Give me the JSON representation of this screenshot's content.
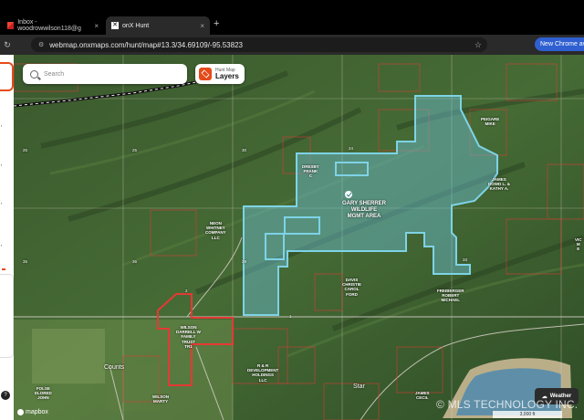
{
  "browser": {
    "tabs": [
      {
        "title": "Inbox - woodrowwilson118@g",
        "icon": "gmail-icon",
        "active": false
      },
      {
        "title": "onX Hunt",
        "icon": "onx-icon",
        "active": true
      }
    ],
    "new_tab": "+",
    "url": "webmap.onxmaps.com/hunt/map#13.3/34.69109/-95.53823",
    "chrome_button": "New Chrome ava"
  },
  "map_ui": {
    "search_placeholder": "Search",
    "layers_small": "Hunt Map",
    "layers_big": "Layers",
    "weather": "Weather",
    "mapbox": "mapbox",
    "scale": [
      "",
      "3,000 ft",
      ""
    ],
    "watermark": "© MLS TECHNOLOGY INC."
  },
  "labels": {
    "wma": "GARY SHERRER\nWILDLIFE\nMGMT AREA",
    "pegasus": "PEIGARE\nMIKE",
    "james": "JAMES\nDOWD L. &\nKATHY A.",
    "dresby": "DRESBY\nFRANK\nC",
    "neon": "NEON\nWHITNEY\nCOMPANY\nLLC",
    "davis": "DAVIS\nCHRISTIE\nCAROL\nFORD",
    "freiberger": "FREIBERGER\nROBERT\nMICHAEL",
    "wilson_family": "WILSON\nDARRELL W\nFAMILY\nTRUST\nTR1",
    "wilson_marty": "WILSON\nMARTY",
    "rr": "R & R\nDEVELOPMENT\nHOLDINGS\nLLC",
    "james_cecil": "JAMES\nCECIL",
    "folse": "FOLSE\nELORED\nJOHN",
    "vic": "VIC\nM\nE"
  },
  "towns": {
    "counts": "Counts",
    "star": "Star"
  },
  "sections": [
    "25",
    "26",
    "30",
    "24",
    "29",
    "35",
    "36",
    "2",
    "5",
    "33",
    "1"
  ],
  "colors": {
    "parcel_red": "#e53935",
    "wma_fill": "#6cc2d6",
    "accent": "#e64a19",
    "chrome_blue": "#2f5fd0"
  }
}
